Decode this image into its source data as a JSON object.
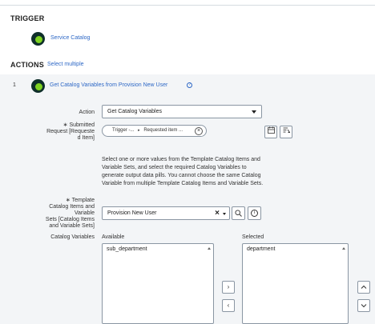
{
  "trigger": {
    "heading": "TRIGGER",
    "label": "Service Catalog",
    "icon": "flow-step-icon"
  },
  "actions": {
    "heading": "ACTIONS",
    "select_multiple": "Select multiple",
    "item": {
      "index": "1",
      "title": "Get Catalog Variables from Provision New User",
      "info_icon": "info-icon"
    }
  },
  "form": {
    "action_label": "Action",
    "action_value": "Get Catalog Variables",
    "submitted_request_label": "Submitted Request [Requested Item]",
    "submitted_request_label_lines": [
      "∗ Submitted",
      "Request [Requeste",
      "d Item]"
    ],
    "pill": {
      "part1": "Trigger -...",
      "separator": "▸",
      "part2": "Requested item ..."
    },
    "help_text": "Select one or more values from the Template Catalog Items and Variable Sets, and select the required Catalog Variables to generate output data pills. You cannot choose the same Catalog Variable from multiple Template Catalog Items and Variable Sets.",
    "template_label_lines": [
      "∗ Template",
      "Catalog Items and",
      "Variable",
      "Sets [Catalog Items",
      "and Variable Sets]"
    ],
    "template_value": "Provision New User",
    "catalog_variables_label": "Catalog Variables",
    "available_heading": "Available",
    "selected_heading": "Selected",
    "available_items": [
      "sub_department"
    ],
    "selected_items": [
      "department"
    ]
  },
  "colors": {
    "link": "#2e68c6",
    "panel_bg": "#f3f5f7",
    "icon_ring": "#0f2f2a",
    "icon_dot": "#7ed321"
  }
}
